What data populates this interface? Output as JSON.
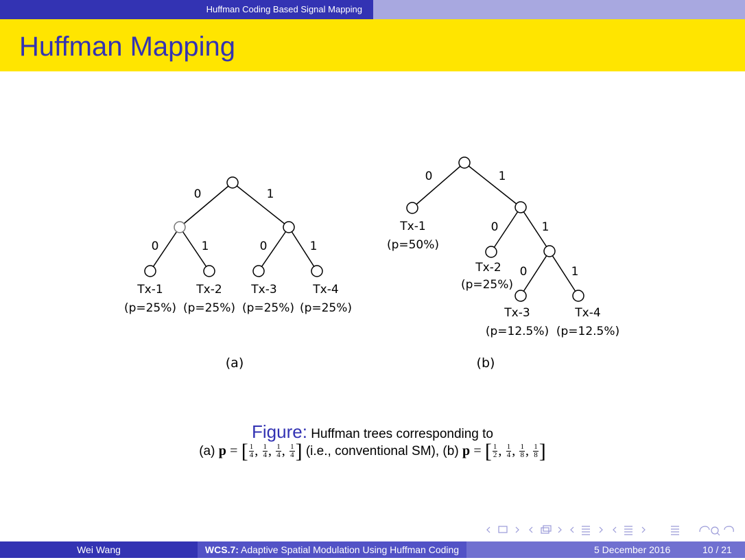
{
  "header": {
    "section": "Huffman Coding Based Signal Mapping"
  },
  "slide": {
    "title": "Huffman Mapping"
  },
  "tree_a": {
    "edges": [
      {
        "label": "0"
      },
      {
        "label": "1"
      },
      {
        "label": "0"
      },
      {
        "label": "1"
      },
      {
        "label": "0"
      },
      {
        "label": "1"
      }
    ],
    "leaves": [
      {
        "name": "Tx-1",
        "prob": "(p=25%)"
      },
      {
        "name": "Tx-2",
        "prob": "(p=25%)"
      },
      {
        "name": "Tx-3",
        "prob": "(p=25%)"
      },
      {
        "name": "Tx-4",
        "prob": "(p=25%)"
      }
    ],
    "caption": "(a)"
  },
  "tree_b": {
    "edges": [
      {
        "label": "0"
      },
      {
        "label": "1"
      },
      {
        "label": "0"
      },
      {
        "label": "1"
      },
      {
        "label": "0"
      },
      {
        "label": "1"
      }
    ],
    "leaves": [
      {
        "name": "Tx-1",
        "prob": "(p=50%)"
      },
      {
        "name": "Tx-2",
        "prob": "(p=25%)"
      },
      {
        "name": "Tx-3",
        "prob": "(p=12.5%)"
      },
      {
        "name": "Tx-4",
        "prob": "(p=12.5%)"
      }
    ],
    "caption": "(b)"
  },
  "figure_caption": {
    "label": "Figure:",
    "line1": "Huffman trees corresponding to",
    "part_a_prefix": "(a)",
    "vec": "p",
    "eq": "=",
    "fracs_a": [
      [
        "1",
        "4"
      ],
      [
        "1",
        "4"
      ],
      [
        "1",
        "4"
      ],
      [
        "1",
        "4"
      ]
    ],
    "middle": "(i.e., conventional SM), (b)",
    "fracs_b": [
      [
        "1",
        "2"
      ],
      [
        "1",
        "4"
      ],
      [
        "1",
        "8"
      ],
      [
        "1",
        "8"
      ]
    ]
  },
  "footer": {
    "author": "Wei Wang",
    "short_title": "WCS.7:",
    "talk_title": "Adaptive Spatial Modulation Using Huffman Coding",
    "date": "5 December 2016",
    "page": "10 / 21"
  }
}
